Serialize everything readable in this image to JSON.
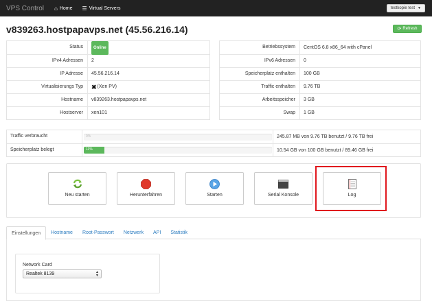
{
  "navbar": {
    "brand": "VPS Control",
    "home_label": "Home",
    "servers_label": "Virtual Servers",
    "user_label": "testkopie test"
  },
  "page": {
    "title": "v839263.hostpapavps.net (45.56.216.14)",
    "refresh_label": "Refresh"
  },
  "left_info": [
    {
      "key": "Status",
      "value": "Online"
    },
    {
      "key": "IPv4 Adressen",
      "value": "2"
    },
    {
      "key": "IP Adresse",
      "value": "45.56.216.14"
    },
    {
      "key": "Virtualisierungs Typ",
      "value": "(Xen PV)"
    },
    {
      "key": "Hostname",
      "value": "v839263.hostpapavps.net"
    },
    {
      "key": "Hostserver",
      "value": "xen101"
    }
  ],
  "right_info": [
    {
      "key": "Betriebssystem",
      "value": "CentOS 6.8 x86_64 with cPanel"
    },
    {
      "key": "IPv6 Adressen",
      "value": "0"
    },
    {
      "key": "Speicherplatz enthalten",
      "value": "100 GB"
    },
    {
      "key": "Traffic enthalten",
      "value": "9.76 TB"
    },
    {
      "key": "Arbeitsspeicher",
      "value": "3 GB"
    },
    {
      "key": "Swap",
      "value": "1 GB"
    }
  ],
  "usage": [
    {
      "label": "Traffic verbraucht",
      "percent": 0,
      "bar_text": "0%",
      "text": "245.87 MB von 9.76 TB benutzt / 9.76 TB frei"
    },
    {
      "label": "Speicherplatz belegt",
      "percent": 11,
      "bar_text": "11%",
      "text": "10.54 GB von 100 GB benutzt / 89.46 GB frei"
    }
  ],
  "actions": {
    "restart": "Neu starten",
    "shutdown": "Herunterfahren",
    "start": "Starten",
    "console": "Serial Konsole",
    "log": "Log"
  },
  "tabs": [
    "Einstellungen",
    "Hostname",
    "Root-Passwort",
    "Netzwerk",
    "API",
    "Statistik"
  ],
  "settings": {
    "network_card_label": "Network Card",
    "network_card_value": "Realtek 8139"
  },
  "colors": {
    "navbar": "#222222",
    "success": "#5cb85c",
    "link": "#2a7bbf",
    "highlight": "#e0161d"
  }
}
